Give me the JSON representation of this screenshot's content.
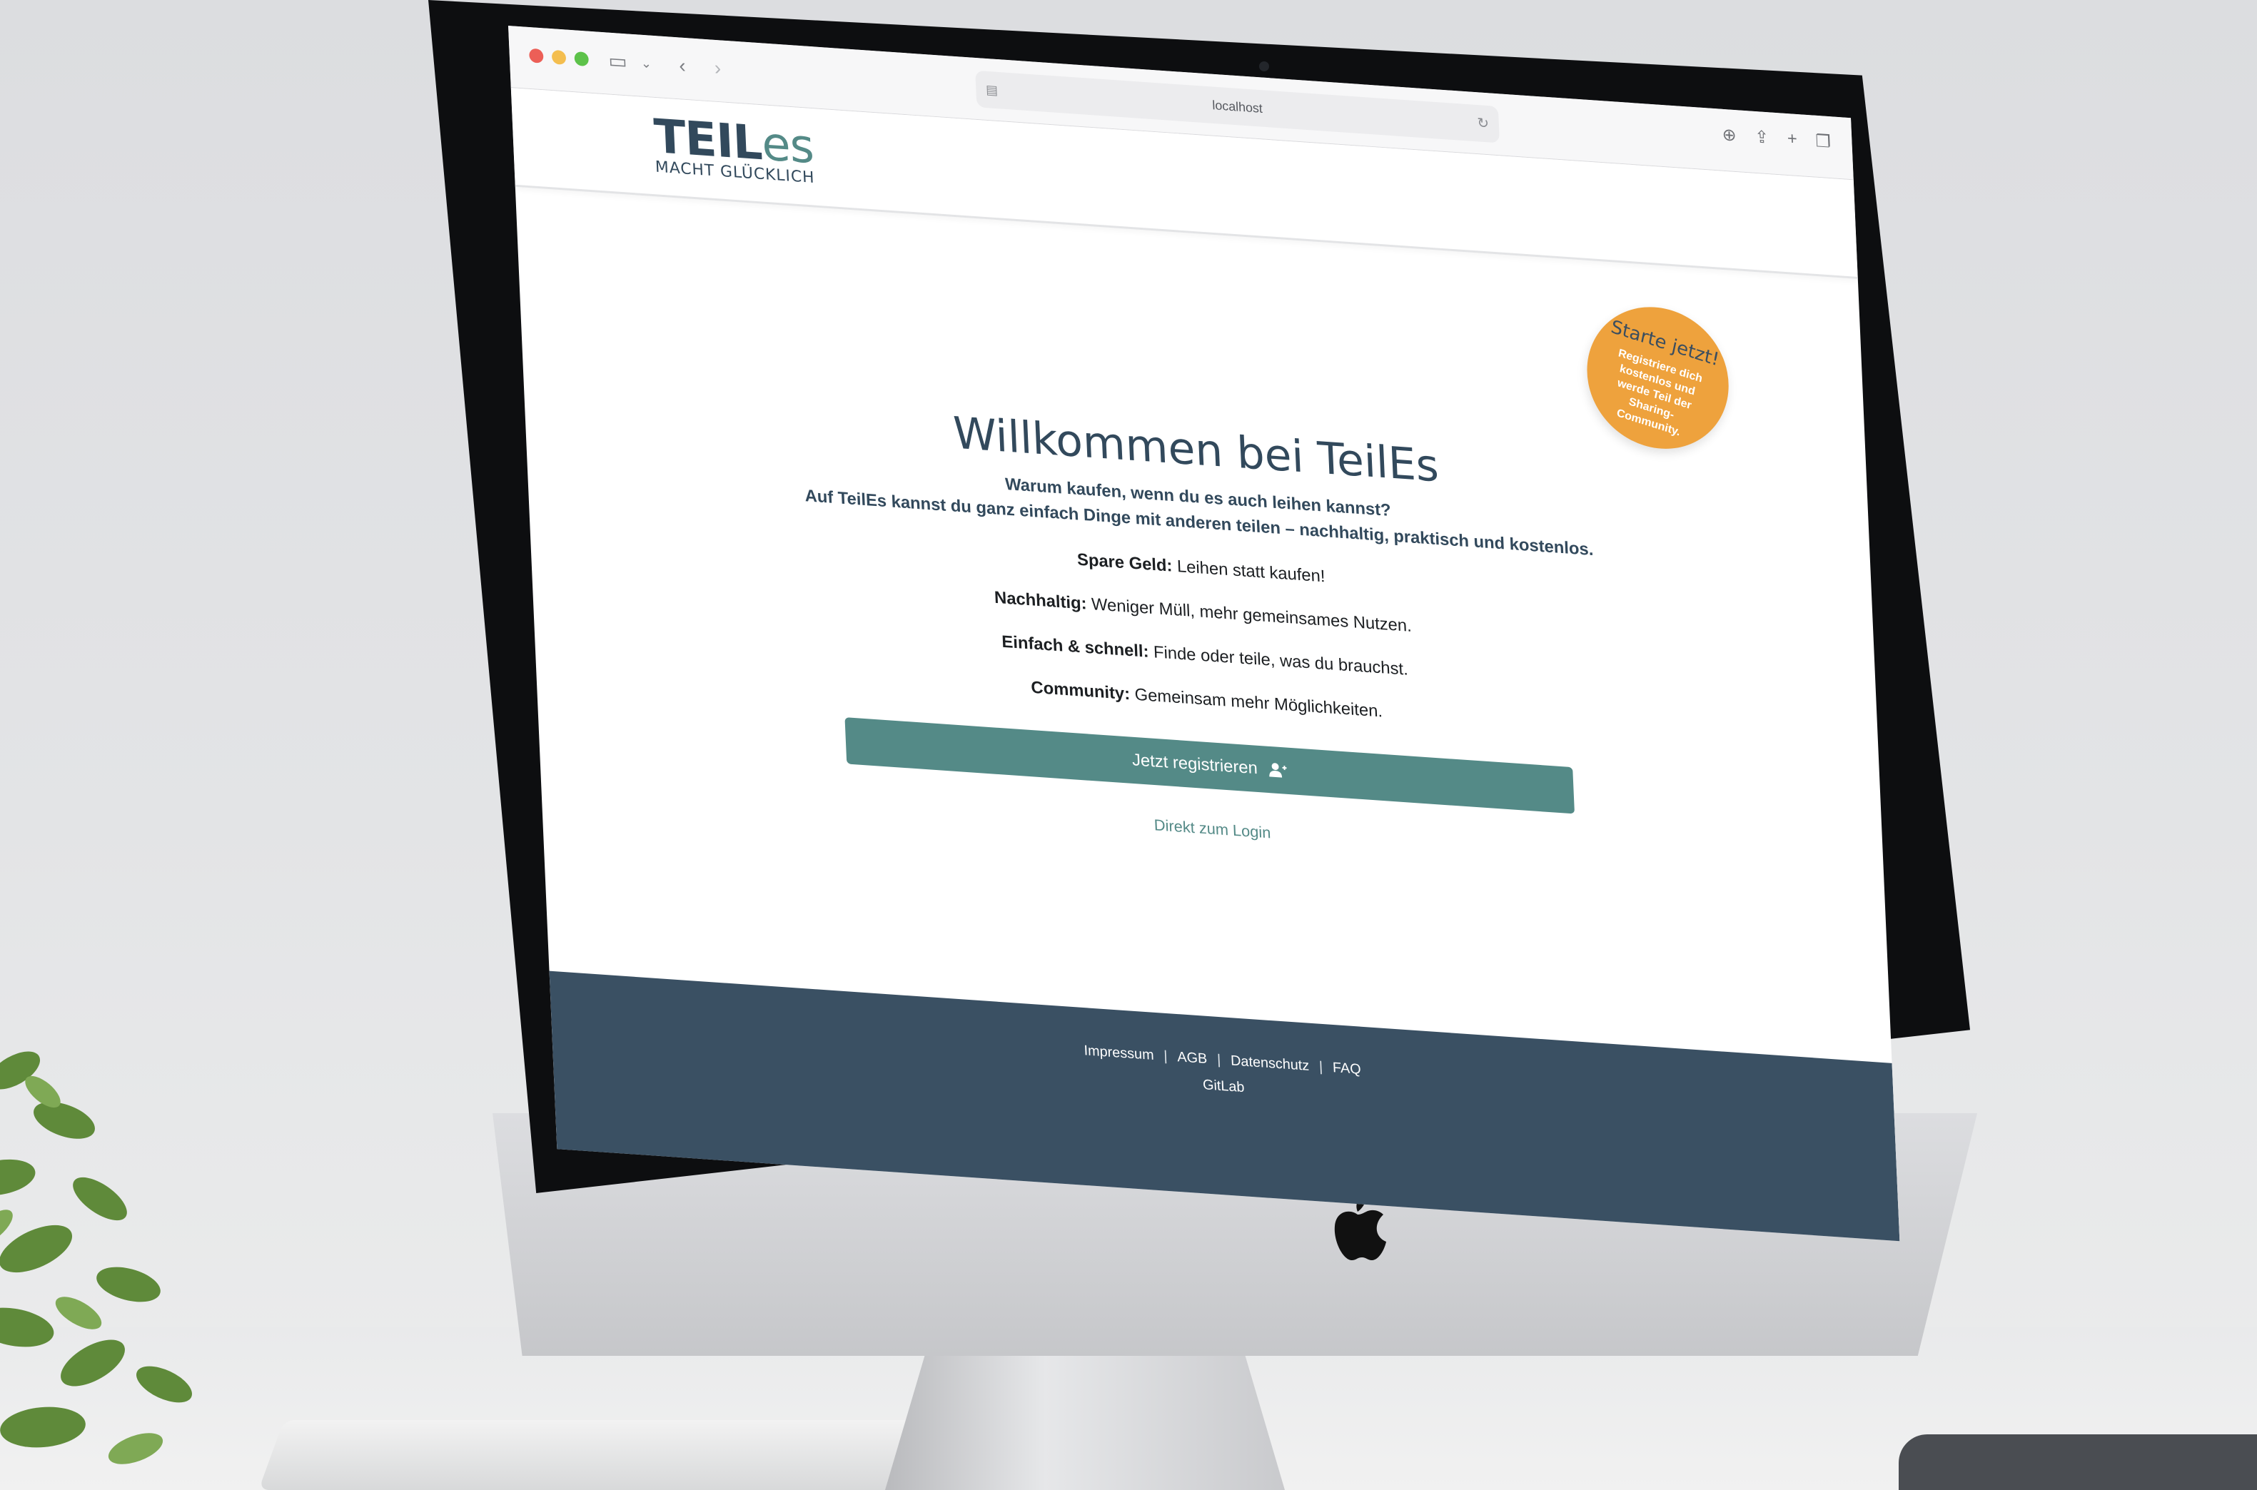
{
  "browser": {
    "url": "localhost"
  },
  "logo": {
    "main_a": "TEIL",
    "main_b": "es",
    "tagline": "MACHT GLÜCKLICH"
  },
  "badge": {
    "title": "Starte jetzt!",
    "text": "Registriere dich kostenlos und werde Teil der Sharing-Community."
  },
  "hero": {
    "headline": "Willkommen bei TeilEs",
    "sub_line_1": "Warum kaufen, wenn du es auch leihen kannst?",
    "sub_line_2": "Auf TeilEs kannst du ganz einfach Dinge mit anderen teilen – nachhaltig, praktisch und kostenlos."
  },
  "features": [
    {
      "label": "Spare Geld:",
      "text": " Leihen statt kaufen!"
    },
    {
      "label": "Nachhaltig:",
      "text": " Weniger Müll, mehr gemeinsames Nutzen."
    },
    {
      "label": "Einfach & schnell:",
      "text": " Finde oder teile, was du brauchst."
    },
    {
      "label": "Community:",
      "text": " Gemeinsam mehr Möglichkeiten."
    }
  ],
  "actions": {
    "register_label": "Jetzt registrieren",
    "login_label": "Direkt zum Login"
  },
  "footer": {
    "links": [
      "Impressum",
      "AGB",
      "Datenschutz",
      "FAQ"
    ],
    "separator": "|",
    "gitlab": "GitLab"
  },
  "colors": {
    "brand_dark": "#32495c",
    "brand_teal": "#548a87",
    "badge_orange": "#eea23d",
    "footer_bg": "#3a5063"
  },
  "icons": [
    "sidebar-icon",
    "chevron-down-icon",
    "back-arrow-icon",
    "forward-arrow-icon",
    "reload-icon",
    "download-icon",
    "share-icon",
    "plus-icon",
    "tabs-icon",
    "user-plus-icon",
    "apple-logo-icon"
  ]
}
